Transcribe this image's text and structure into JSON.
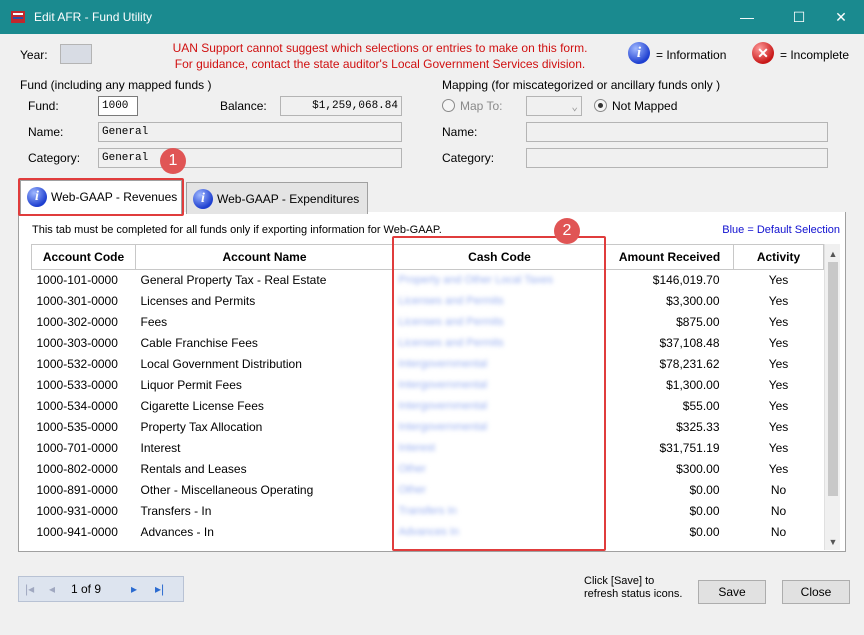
{
  "window": {
    "title": "Edit AFR - Fund Utility",
    "minimize": "—",
    "maximize": "☐",
    "close": "✕"
  },
  "header": {
    "year_label": "Year:",
    "warning_line1": "UAN Support cannot suggest which selections or entries to make on this form.",
    "warning_line2": "For guidance, contact the state auditor's Local Government Services division.",
    "legend_info": "= Information",
    "legend_incomplete": "= Incomplete"
  },
  "fund": {
    "section_label": "Fund  (including any mapped funds )",
    "fund_label": "Fund:",
    "fund_value": "1000",
    "balance_label": "Balance:",
    "balance_value": "$1,259,068.84",
    "name_label": "Name:",
    "name_value": "General",
    "category_label": "Category:",
    "category_value": "General"
  },
  "mapping": {
    "section_label": "Mapping  (for miscategorized or ancillary funds only )",
    "map_to_label": "Map To:",
    "not_mapped_label": "Not Mapped",
    "name_label": "Name:",
    "category_label": "Category:"
  },
  "tabs": [
    {
      "label": "Web-GAAP - Revenues"
    },
    {
      "label": "Web-GAAP - Expenditures"
    }
  ],
  "panel": {
    "note": "This tab must be completed for all funds only if exporting information for Web-GAAP.",
    "blue_note": "Blue = Default Selection"
  },
  "grid": {
    "columns": [
      "Account Code",
      "Account Name",
      "Cash Code",
      "Amount Received",
      "Activity"
    ],
    "rows": [
      {
        "code": "1000-101-0000",
        "name": "General Property Tax - Real Estate",
        "cash": "Property and Other Local Taxes",
        "amount": "$146,019.70",
        "activity": "Yes"
      },
      {
        "code": "1000-301-0000",
        "name": "Licenses and Permits",
        "cash": "Licenses and Permits",
        "amount": "$3,300.00",
        "activity": "Yes"
      },
      {
        "code": "1000-302-0000",
        "name": "Fees",
        "cash": "Licenses and Permits",
        "amount": "$875.00",
        "activity": "Yes"
      },
      {
        "code": "1000-303-0000",
        "name": "Cable Franchise Fees",
        "cash": "Licenses and Permits",
        "amount": "$37,108.48",
        "activity": "Yes"
      },
      {
        "code": "1000-532-0000",
        "name": "Local Government Distribution",
        "cash": "Intergovernmental",
        "amount": "$78,231.62",
        "activity": "Yes"
      },
      {
        "code": "1000-533-0000",
        "name": "Liquor Permit Fees",
        "cash": "Intergovernmental",
        "amount": "$1,300.00",
        "activity": "Yes"
      },
      {
        "code": "1000-534-0000",
        "name": "Cigarette License Fees",
        "cash": "Intergovernmental",
        "amount": "$55.00",
        "activity": "Yes"
      },
      {
        "code": "1000-535-0000",
        "name": "Property Tax Allocation",
        "cash": "Intergovernmental",
        "amount": "$325.33",
        "activity": "Yes"
      },
      {
        "code": "1000-701-0000",
        "name": "Interest",
        "cash": "Interest",
        "amount": "$31,751.19",
        "activity": "Yes"
      },
      {
        "code": "1000-802-0000",
        "name": "Rentals and Leases",
        "cash": "Other",
        "amount": "$300.00",
        "activity": "Yes"
      },
      {
        "code": "1000-891-0000",
        "name": "Other - Miscellaneous Operating",
        "cash": "Other",
        "amount": "$0.00",
        "activity": "No"
      },
      {
        "code": "1000-931-0000",
        "name": "Transfers - In",
        "cash": "Transfers In",
        "amount": "$0.00",
        "activity": "No"
      },
      {
        "code": "1000-941-0000",
        "name": "Advances - In",
        "cash": "Advances In",
        "amount": "$0.00",
        "activity": "No"
      }
    ]
  },
  "callouts": {
    "one": "1",
    "two": "2"
  },
  "pager": {
    "first": "|◂",
    "prev": "◂",
    "position": "1  of 9",
    "next": "▸",
    "last": "▸|"
  },
  "footer": {
    "hint_line1": "Click [Save] to",
    "hint_line2": "refresh status icons.",
    "save_label": "Save",
    "close_label": "Close"
  },
  "icons": {
    "app": "app-logo-icon",
    "info": "information-icon",
    "incomplete": "incomplete-x-icon"
  }
}
